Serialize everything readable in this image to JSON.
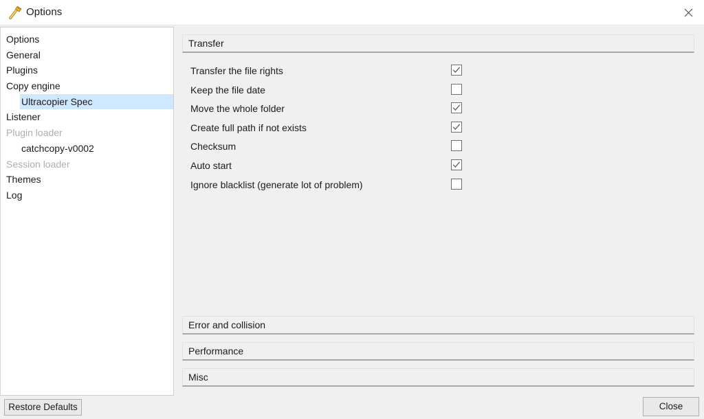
{
  "window": {
    "title": "Options",
    "icon": "hammer-icon",
    "close_icon": "close-icon",
    "background": "#f0f0f0",
    "titlebar_background": "#ffffff"
  },
  "sidebar": {
    "selection_color": "#cde8ff",
    "items": [
      {
        "label": "Options",
        "indent": 0,
        "disabled": false,
        "selected": false
      },
      {
        "label": "General",
        "indent": 0,
        "disabled": false,
        "selected": false
      },
      {
        "label": "Plugins",
        "indent": 0,
        "disabled": false,
        "selected": false
      },
      {
        "label": "Copy engine",
        "indent": 0,
        "disabled": false,
        "selected": false
      },
      {
        "label": "Ultracopier Spec",
        "indent": 1,
        "disabled": false,
        "selected": true
      },
      {
        "label": "Listener",
        "indent": 0,
        "disabled": false,
        "selected": false
      },
      {
        "label": "Plugin loader",
        "indent": 0,
        "disabled": true,
        "selected": false
      },
      {
        "label": "catchcopy-v0002",
        "indent": 1,
        "disabled": false,
        "selected": false
      },
      {
        "label": "Session loader",
        "indent": 0,
        "disabled": true,
        "selected": false
      },
      {
        "label": "Themes",
        "indent": 0,
        "disabled": false,
        "selected": false
      },
      {
        "label": "Log",
        "indent": 0,
        "disabled": false,
        "selected": false
      }
    ]
  },
  "main": {
    "transfer_section": {
      "title": "Transfer",
      "expanded": true,
      "options": [
        {
          "label": "Transfer the file rights",
          "checked": true
        },
        {
          "label": "Keep the file date",
          "checked": false
        },
        {
          "label": "Move the whole folder",
          "checked": true
        },
        {
          "label": "Create full path if not exists",
          "checked": true
        },
        {
          "label": "Checksum",
          "checked": false
        },
        {
          "label": "Auto start",
          "checked": true
        },
        {
          "label": "Ignore blacklist (generate lot of problem)",
          "checked": false
        }
      ]
    },
    "collapsed_sections": [
      {
        "title": "Error and collision"
      },
      {
        "title": "Performance"
      },
      {
        "title": "Misc"
      }
    ]
  },
  "footer": {
    "restore_defaults_label": "Restore Defaults",
    "close_label": "Close"
  }
}
